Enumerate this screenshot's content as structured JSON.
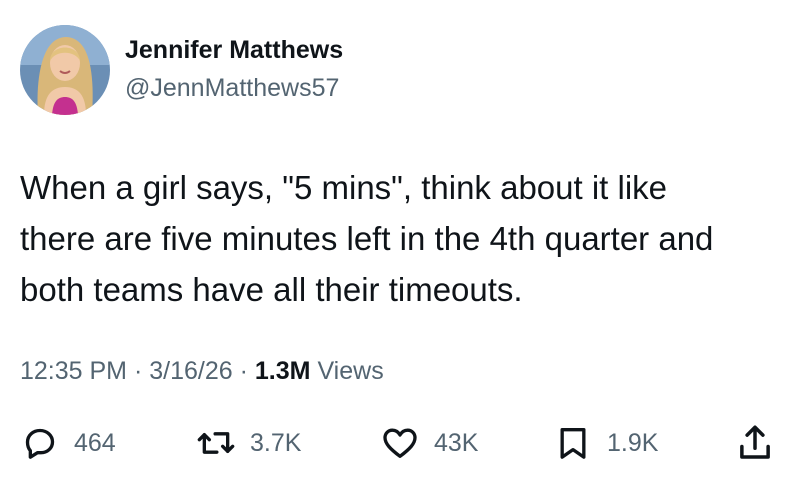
{
  "author": {
    "display_name": "Jennifer Matthews",
    "handle": "@JennMatthews57"
  },
  "tweet": {
    "text_lines": [
      "When a girl says, \"5 mins\", think about it like",
      "there are five minutes left in the 4th quarter and",
      "both teams have all their timeouts."
    ],
    "time": "12:35 PM",
    "date": "3/16/26",
    "separator": "·",
    "views_count": "1.3M",
    "views_label": "Views"
  },
  "actions": {
    "replies": "464",
    "retweets": "3.7K",
    "likes": "43K",
    "bookmarks": "1.9K"
  },
  "icons": [
    "reply-icon",
    "retweet-icon",
    "like-icon",
    "bookmark-icon",
    "share-icon"
  ],
  "colors": {
    "text_primary": "#0f1419",
    "text_secondary": "#536471",
    "background": "#ffffff"
  }
}
